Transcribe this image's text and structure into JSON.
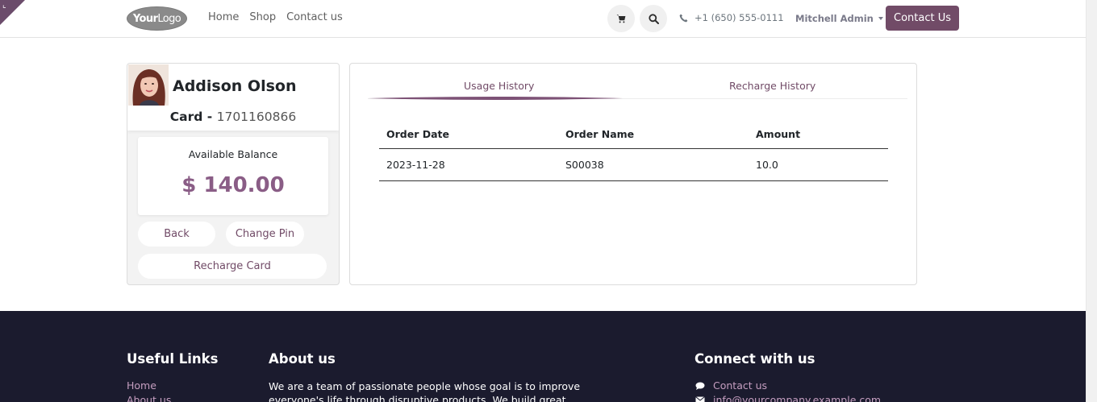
{
  "header": {
    "logo_text_bold": "Your",
    "logo_text": "Logo",
    "nav": [
      "Home",
      "Shop",
      "Contact us"
    ],
    "phone": "+1 (650) 555-0111",
    "user_name": "Mitchell Admin",
    "contact_button": "Contact Us",
    "icons": [
      "cart-icon",
      "search-icon",
      "phone-icon",
      "chevron-down-icon"
    ]
  },
  "profile": {
    "name": "Addison Olson",
    "card_label": "Card - ",
    "card_number": "1701160866",
    "balance_label": "Available Balance",
    "balance": "$ 140.00",
    "buttons": {
      "back": "Back",
      "change_pin": "Change Pin",
      "recharge": "Recharge Card"
    }
  },
  "history": {
    "tabs": [
      "Usage History",
      "Recharge History"
    ],
    "active_tab": "Usage History",
    "columns": [
      "Order Date",
      "Order Name",
      "Amount"
    ],
    "rows": [
      {
        "date": "2023-11-28",
        "name": "S00038",
        "amount": "10.0"
      }
    ]
  },
  "footer": {
    "useful_links_title": "Useful Links",
    "useful_links": [
      "Home",
      "About us"
    ],
    "about_title": "About us",
    "about_text": "We are a team of passionate people whose goal is to improve everyone's life through disruptive products. We build great products to",
    "connect_title": "Connect with us",
    "connect_links": [
      "Contact us",
      "info@yourcompany.example.com"
    ]
  },
  "colors": {
    "brand": "#714b67",
    "balance": "#8a5d86",
    "footer_bg": "#1b1b2e",
    "footer_link": "#c59ec0"
  }
}
